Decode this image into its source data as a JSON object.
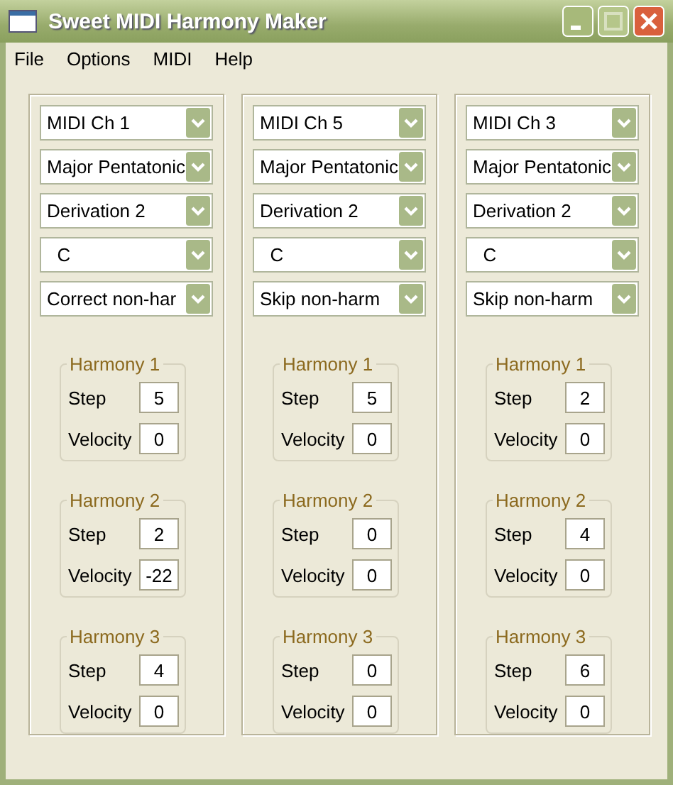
{
  "window": {
    "title": "Sweet MIDI Harmony Maker"
  },
  "menu": [
    "File",
    "Options",
    "MIDI",
    "Help"
  ],
  "panels": [
    {
      "dropdowns": [
        "MIDI Ch 1",
        "Major Pentatonic",
        "Derivation 2",
        "  C",
        "Correct non-har"
      ],
      "harmonies": [
        {
          "title": "Harmony 1",
          "step_label": "Step",
          "step": "5",
          "velocity_label": "Velocity",
          "velocity": "0"
        },
        {
          "title": "Harmony 2",
          "step_label": "Step",
          "step": "2",
          "velocity_label": "Velocity",
          "velocity": "-22"
        },
        {
          "title": "Harmony 3",
          "step_label": "Step",
          "step": "4",
          "velocity_label": "Velocity",
          "velocity": "0"
        }
      ]
    },
    {
      "dropdowns": [
        "MIDI Ch 5",
        "Major Pentatonic",
        "Derivation 2",
        "  C",
        "Skip non-harm"
      ],
      "harmonies": [
        {
          "title": "Harmony 1",
          "step_label": "Step",
          "step": "5",
          "velocity_label": "Velocity",
          "velocity": "0"
        },
        {
          "title": "Harmony 2",
          "step_label": "Step",
          "step": "0",
          "velocity_label": "Velocity",
          "velocity": "0"
        },
        {
          "title": "Harmony 3",
          "step_label": "Step",
          "step": "0",
          "velocity_label": "Velocity",
          "velocity": "0"
        }
      ]
    },
    {
      "dropdowns": [
        "MIDI Ch 3",
        "Major Pentatonic",
        "Derivation 2",
        "  C",
        "Skip non-harm"
      ],
      "harmonies": [
        {
          "title": "Harmony 1",
          "step_label": "Step",
          "step": "2",
          "velocity_label": "Velocity",
          "velocity": "0"
        },
        {
          "title": "Harmony 2",
          "step_label": "Step",
          "step": "4",
          "velocity_label": "Velocity",
          "velocity": "0"
        },
        {
          "title": "Harmony 3",
          "step_label": "Step",
          "step": "6",
          "velocity_label": "Velocity",
          "velocity": "0"
        }
      ]
    }
  ]
}
